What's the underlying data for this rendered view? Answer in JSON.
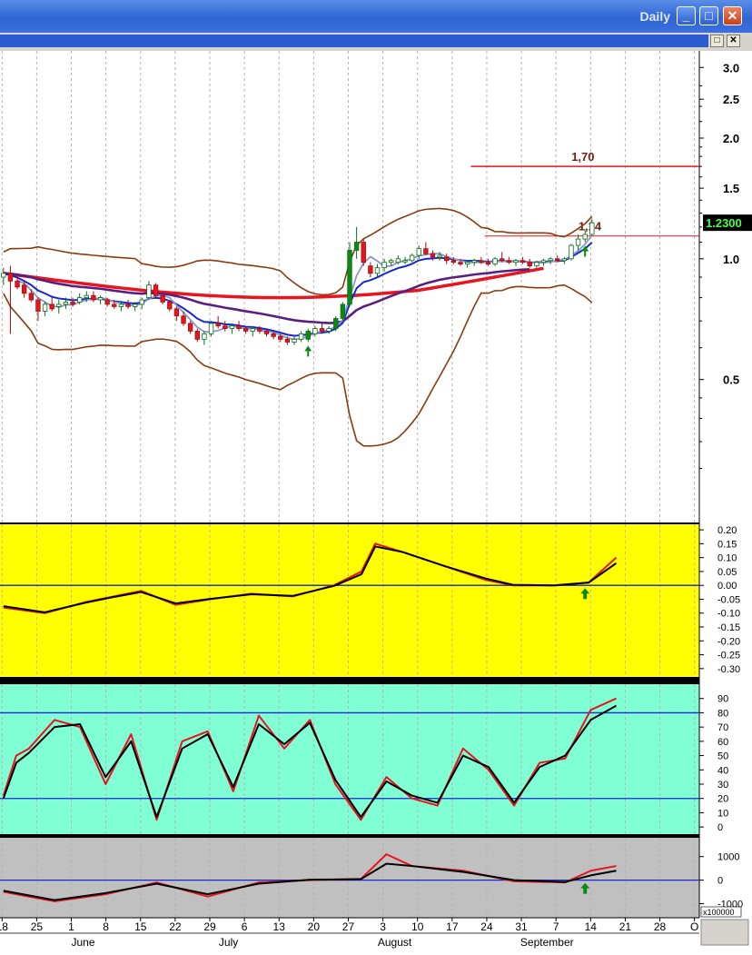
{
  "window": {
    "title": "Daily",
    "buttons": {
      "minimize": "_",
      "maximize": "□",
      "close": "✕"
    },
    "mdi_buttons": {
      "restore": "□",
      "close": "✕"
    }
  },
  "colors": {
    "price_bg": "#ffffff",
    "macd_bg": "#ffff00",
    "stoch_bg": "#80ffd4",
    "osc_bg": "#c0c0c0",
    "red": "#e8141e",
    "blue": "#1428d2",
    "brown": "#8b3a0e",
    "purple": "#5a1e82",
    "lightblue": "#8c96c8",
    "green_candle": "#0a8a14"
  },
  "chart_data": [
    {
      "type": "candlestick",
      "panel": "price",
      "scale": "log",
      "ylim": [
        0.22,
        3.3
      ],
      "ytick_labels": [
        "3.0",
        "2.5",
        "2.0",
        "1.5",
        "1.0",
        "0.5"
      ],
      "yticks": [
        3.0,
        2.5,
        2.0,
        1.5,
        1.0,
        0.5
      ],
      "last_price_label": "1.2300",
      "last_price": 1.23,
      "horizontal_lines": [
        {
          "label": "1,70",
          "value": 1.7,
          "from_day": 68
        },
        {
          "label": "1,14",
          "value": 1.14,
          "from_day": 70
        }
      ],
      "candles": [
        [
          0.9,
          0.95,
          0.86,
          0.92
        ],
        [
          0.92,
          0.96,
          0.65,
          0.88
        ],
        [
          0.88,
          0.92,
          0.84,
          0.85
        ],
        [
          0.86,
          0.88,
          0.8,
          0.82
        ],
        [
          0.82,
          0.84,
          0.78,
          0.79
        ],
        [
          0.79,
          0.8,
          0.7,
          0.74
        ],
        [
          0.74,
          0.78,
          0.72,
          0.77
        ],
        [
          0.77,
          0.8,
          0.74,
          0.75
        ],
        [
          0.76,
          0.79,
          0.73,
          0.77
        ],
        [
          0.77,
          0.8,
          0.75,
          0.78
        ],
        [
          0.78,
          0.8,
          0.76,
          0.77
        ],
        [
          0.78,
          0.82,
          0.77,
          0.8
        ],
        [
          0.8,
          0.83,
          0.78,
          0.81
        ],
        [
          0.81,
          0.83,
          0.78,
          0.79
        ],
        [
          0.79,
          0.81,
          0.77,
          0.8
        ],
        [
          0.79,
          0.8,
          0.76,
          0.77
        ],
        [
          0.77,
          0.79,
          0.75,
          0.76
        ],
        [
          0.76,
          0.78,
          0.74,
          0.77
        ],
        [
          0.77,
          0.79,
          0.75,
          0.76
        ],
        [
          0.76,
          0.78,
          0.74,
          0.77
        ],
        [
          0.77,
          0.8,
          0.75,
          0.79
        ],
        [
          0.8,
          0.88,
          0.79,
          0.86
        ],
        [
          0.86,
          0.87,
          0.8,
          0.81
        ],
        [
          0.81,
          0.82,
          0.77,
          0.78
        ],
        [
          0.78,
          0.79,
          0.74,
          0.75
        ],
        [
          0.75,
          0.76,
          0.7,
          0.72
        ],
        [
          0.72,
          0.74,
          0.68,
          0.69
        ],
        [
          0.69,
          0.7,
          0.65,
          0.66
        ],
        [
          0.66,
          0.67,
          0.62,
          0.63
        ],
        [
          0.63,
          0.66,
          0.61,
          0.65
        ],
        [
          0.65,
          0.7,
          0.64,
          0.69
        ],
        [
          0.69,
          0.72,
          0.67,
          0.68
        ],
        [
          0.68,
          0.7,
          0.66,
          0.67
        ],
        [
          0.67,
          0.69,
          0.65,
          0.68
        ],
        [
          0.68,
          0.7,
          0.66,
          0.67
        ],
        [
          0.67,
          0.68,
          0.65,
          0.66
        ],
        [
          0.66,
          0.68,
          0.64,
          0.67
        ],
        [
          0.67,
          0.68,
          0.65,
          0.66
        ],
        [
          0.66,
          0.67,
          0.64,
          0.65
        ],
        [
          0.65,
          0.66,
          0.63,
          0.64
        ],
        [
          0.64,
          0.65,
          0.62,
          0.63
        ],
        [
          0.63,
          0.64,
          0.61,
          0.62
        ],
        [
          0.62,
          0.64,
          0.61,
          0.63
        ],
        [
          0.63,
          0.66,
          0.62,
          0.65
        ],
        [
          0.63,
          0.67,
          0.62,
          0.66
        ],
        [
          0.65,
          0.68,
          0.64,
          0.67
        ],
        [
          0.67,
          0.69,
          0.65,
          0.66
        ],
        [
          0.66,
          0.68,
          0.65,
          0.67
        ],
        [
          0.67,
          0.72,
          0.66,
          0.71
        ],
        [
          0.71,
          0.78,
          0.7,
          0.77
        ],
        [
          0.77,
          1.1,
          0.76,
          1.05
        ],
        [
          1.05,
          1.2,
          1.0,
          1.1
        ],
        [
          1.1,
          1.12,
          0.96,
          0.98
        ],
        [
          0.96,
          0.98,
          0.9,
          0.92
        ],
        [
          0.92,
          0.97,
          0.9,
          0.95
        ],
        [
          0.95,
          1.0,
          0.93,
          0.98
        ],
        [
          0.98,
          1.0,
          0.96,
          0.99
        ],
        [
          0.98,
          1.02,
          0.97,
          1.0
        ],
        [
          0.99,
          1.01,
          0.97,
          0.99
        ],
        [
          0.99,
          1.03,
          0.98,
          1.02
        ],
        [
          1.02,
          1.08,
          1.0,
          1.06
        ],
        [
          1.06,
          1.1,
          1.02,
          1.03
        ],
        [
          1.03,
          1.05,
          0.99,
          1.01
        ],
        [
          1.01,
          1.04,
          0.99,
          1.02
        ],
        [
          1.01,
          1.03,
          0.97,
          0.99
        ],
        [
          0.99,
          1.01,
          0.97,
          0.98
        ],
        [
          0.98,
          1.0,
          0.96,
          0.97
        ],
        [
          0.97,
          0.99,
          0.95,
          0.98
        ],
        [
          0.98,
          1.0,
          0.96,
          0.99
        ],
        [
          0.99,
          1.01,
          0.97,
          0.98
        ],
        [
          0.98,
          1.0,
          0.96,
          0.97
        ],
        [
          0.97,
          1.01,
          0.96,
          1.0
        ],
        [
          1.0,
          1.04,
          0.98,
          0.99
        ],
        [
          0.99,
          1.01,
          0.97,
          0.98
        ],
        [
          0.98,
          1.0,
          0.96,
          0.99
        ],
        [
          0.99,
          1.01,
          0.97,
          0.98
        ],
        [
          0.98,
          1.0,
          0.95,
          0.96
        ],
        [
          0.96,
          0.99,
          0.95,
          0.98
        ],
        [
          0.98,
          1.0,
          0.96,
          0.99
        ],
        [
          0.99,
          1.01,
          0.97,
          1.0
        ],
        [
          1.0,
          1.02,
          0.98,
          0.99
        ],
        [
          0.99,
          1.01,
          0.97,
          1.0
        ],
        [
          1.0,
          1.09,
          0.99,
          1.08
        ],
        [
          1.08,
          1.15,
          1.05,
          1.12
        ],
        [
          1.12,
          1.18,
          1.1,
          1.15
        ],
        [
          1.15,
          1.26,
          1.14,
          1.23
        ]
      ],
      "overlays": [
        "bollinger_upper",
        "bollinger_lower",
        "ma_fast_blue",
        "ma_mid_purple",
        "ma_slow_red",
        "ma_lightblue"
      ],
      "signal_arrows_at_day": [
        44,
        84
      ]
    },
    {
      "type": "line",
      "panel": "macd",
      "ylim": [
        -0.33,
        0.22
      ],
      "ytick_labels": [
        "0.20",
        "0.15",
        "0.10",
        "0.05",
        "0.00",
        "-0.05",
        "-0.10",
        "-0.15",
        "-0.20",
        "-0.25",
        "-0.30"
      ],
      "yticks": [
        0.2,
        0.15,
        0.1,
        0.05,
        0.0,
        -0.05,
        -0.1,
        -0.15,
        -0.2,
        -0.25,
        -0.3
      ],
      "reference_lines": [
        0.0
      ],
      "series": [
        {
          "key": [
            [
              0,
              -0.08
            ],
            [
              6,
              -0.1
            ],
            [
              12,
              -0.06
            ],
            [
              16,
              -0.04
            ],
            [
              20,
              -0.02
            ],
            [
              25,
              -0.07
            ],
            [
              30,
              -0.05
            ],
            [
              36,
              -0.03
            ],
            [
              42,
              -0.04
            ],
            [
              48,
              0.0
            ],
            [
              52,
              0.05
            ],
            [
              54,
              0.15
            ],
            [
              58,
              0.12
            ],
            [
              64,
              0.07
            ],
            [
              70,
              0.02
            ],
            [
              74,
              0.0
            ],
            [
              80,
              0.0
            ],
            [
              85,
              0.01
            ],
            [
              89,
              0.1
            ]
          ]
        },
        {
          "key": [
            [
              0,
              -0.075
            ],
            [
              6,
              -0.097
            ],
            [
              12,
              -0.062
            ],
            [
              16,
              -0.042
            ],
            [
              20,
              -0.024
            ],
            [
              25,
              -0.065
            ],
            [
              30,
              -0.049
            ],
            [
              36,
              -0.032
            ],
            [
              42,
              -0.038
            ],
            [
              48,
              -0.002
            ],
            [
              52,
              0.04
            ],
            [
              54,
              0.14
            ],
            [
              58,
              0.12
            ],
            [
              64,
              0.07
            ],
            [
              70,
              0.025
            ],
            [
              74,
              0.002
            ],
            [
              80,
              0.0
            ],
            [
              85,
              0.01
            ],
            [
              89,
              0.08
            ]
          ]
        }
      ],
      "signal_arrow_at_day": 84
    },
    {
      "type": "line",
      "panel": "stochastic",
      "ylim": [
        -5,
        100
      ],
      "ytick_labels": [
        "90",
        "80",
        "70",
        "60",
        "50",
        "40",
        "30",
        "20",
        "10",
        "0"
      ],
      "yticks": [
        90,
        80,
        70,
        60,
        50,
        40,
        30,
        20,
        10,
        0
      ],
      "reference_lines": [
        80,
        20
      ],
      "series": [
        {
          "key": [
            [
              0,
              22
            ],
            [
              1,
              50
            ],
            [
              2,
              55
            ],
            [
              4,
              75
            ],
            [
              6,
              70
            ],
            [
              8,
              30
            ],
            [
              10,
              65
            ],
            [
              12,
              5
            ],
            [
              14,
              60
            ],
            [
              16,
              67
            ],
            [
              18,
              25
            ],
            [
              20,
              78
            ],
            [
              22,
              55
            ],
            [
              24,
              75
            ],
            [
              26,
              30
            ],
            [
              28,
              5
            ],
            [
              30,
              35
            ],
            [
              32,
              20
            ],
            [
              34,
              15
            ],
            [
              36,
              55
            ],
            [
              38,
              40
            ],
            [
              40,
              15
            ],
            [
              42,
              45
            ],
            [
              44,
              48
            ],
            [
              46,
              82
            ],
            [
              48,
              90
            ]
          ]
        },
        {
          "key": [
            [
              0,
              20
            ],
            [
              1,
              45
            ],
            [
              2,
              52
            ],
            [
              4,
              70
            ],
            [
              6,
              72
            ],
            [
              8,
              35
            ],
            [
              10,
              60
            ],
            [
              12,
              7
            ],
            [
              14,
              55
            ],
            [
              16,
              65
            ],
            [
              18,
              28
            ],
            [
              20,
              72
            ],
            [
              22,
              58
            ],
            [
              24,
              73
            ],
            [
              26,
              33
            ],
            [
              28,
              7
            ],
            [
              30,
              32
            ],
            [
              32,
              22
            ],
            [
              34,
              17
            ],
            [
              36,
              50
            ],
            [
              38,
              42
            ],
            [
              40,
              17
            ],
            [
              42,
              42
            ],
            [
              44,
              50
            ],
            [
              46,
              75
            ],
            [
              48,
              85
            ]
          ]
        }
      ]
    },
    {
      "type": "line",
      "panel": "oscillator",
      "ylim": [
        -1600,
        1800
      ],
      "ytick_labels": [
        "1000",
        "0",
        "-1000"
      ],
      "yticks": [
        1000,
        0,
        -1000
      ],
      "multiplier_label": "x100000",
      "reference_lines": [
        0
      ],
      "series": [
        {
          "key": [
            [
              0,
              -500
            ],
            [
              4,
              -900
            ],
            [
              8,
              -600
            ],
            [
              12,
              -100
            ],
            [
              16,
              -700
            ],
            [
              20,
              -100
            ],
            [
              24,
              0
            ],
            [
              28,
              50
            ],
            [
              30,
              1100
            ],
            [
              32,
              600
            ],
            [
              36,
              400
            ],
            [
              40,
              -50
            ],
            [
              44,
              -100
            ],
            [
              46,
              400
            ],
            [
              48,
              600
            ]
          ]
        },
        {
          "key": [
            [
              0,
              -450
            ],
            [
              4,
              -850
            ],
            [
              8,
              -550
            ],
            [
              12,
              -150
            ],
            [
              16,
              -600
            ],
            [
              20,
              -150
            ],
            [
              24,
              20
            ],
            [
              28,
              40
            ],
            [
              30,
              700
            ],
            [
              32,
              600
            ],
            [
              36,
              350
            ],
            [
              40,
              0
            ],
            [
              44,
              -80
            ],
            [
              46,
              200
            ],
            [
              48,
              400
            ]
          ]
        }
      ],
      "signal_arrow_at_day": 84
    }
  ],
  "x_axis": {
    "day_labels": [
      {
        "text": "18",
        "day": 0
      },
      {
        "text": "25",
        "day": 5
      },
      {
        "text": "1",
        "day": 10
      },
      {
        "text": "8",
        "day": 15
      },
      {
        "text": "15",
        "day": 20
      },
      {
        "text": "22",
        "day": 25
      },
      {
        "text": "29",
        "day": 30
      },
      {
        "text": "6",
        "day": 35
      },
      {
        "text": "13",
        "day": 40
      },
      {
        "text": "20",
        "day": 45
      },
      {
        "text": "27",
        "day": 50
      },
      {
        "text": "3",
        "day": 55
      },
      {
        "text": "10",
        "day": 60
      },
      {
        "text": "17",
        "day": 65
      },
      {
        "text": "24",
        "day": 70
      },
      {
        "text": "31",
        "day": 75
      },
      {
        "text": "7",
        "day": 80
      },
      {
        "text": "14",
        "day": 85
      },
      {
        "text": "21",
        "day": 90
      },
      {
        "text": "28",
        "day": 95
      },
      {
        "text": "O",
        "day": 100
      }
    ],
    "month_labels": [
      {
        "text": "June",
        "day": 12
      },
      {
        "text": "July",
        "day": 33
      },
      {
        "text": "August",
        "day": 57
      },
      {
        "text": "September",
        "day": 79
      }
    ]
  }
}
